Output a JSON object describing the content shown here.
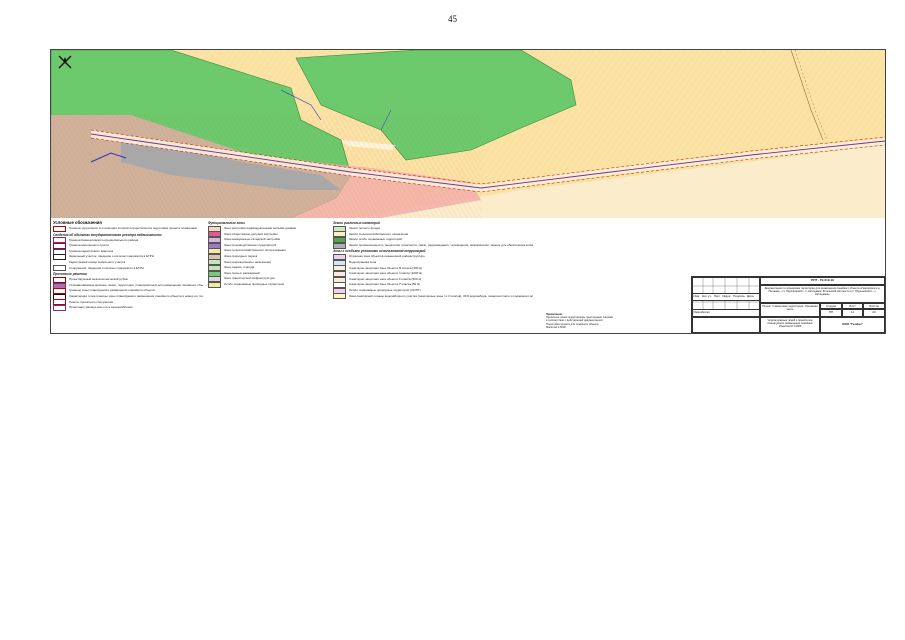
{
  "page_number": "45",
  "legend": {
    "title": "Условные обозначения",
    "col1": [
      {
        "kind": "item",
        "text": "Граница территории, в отношении которой осуществляется подготовка проекта планировки",
        "color": "#ffffff",
        "border": "#c00000"
      },
      {
        "kind": "sub",
        "text": "Сведения об объектах государственного реестра недвижимости"
      },
      {
        "kind": "item",
        "text": "Граница Камышловского муниципального района",
        "color": "#ffffff",
        "border": "#7a2d91"
      },
      {
        "kind": "item",
        "text": "Граница населенного пункта",
        "color": "#ffffff",
        "border": "#c00000"
      },
      {
        "kind": "item",
        "text": "Граница кадастрового квартала",
        "color": "#ffffff",
        "border": "#3030c0"
      },
      {
        "kind": "item",
        "text": "Земельный участок, сведения о котором содержатся в ЕГРН",
        "color": "#ffffff",
        "border": "#222222"
      },
      {
        "kind": "item",
        "text": "Кадастровый номер земельного участка",
        "color": "#ffffff",
        "border": "#ffffff"
      },
      {
        "kind": "item",
        "text": "Сооружения, сведения о которых содержатся в ЕГРН",
        "color": "#ffffff",
        "border": "#555555"
      },
      {
        "kind": "sub",
        "text": "Проектные решения"
      },
      {
        "kind": "item",
        "text": "Проектируемый межпоселенческий рубеж",
        "color": "#ffffff",
        "border": "#a00000"
      },
      {
        "kind": "item",
        "text": "Устанавливаемые красные линии, территория, планировочной для размещения линейного объекта",
        "color": "#b070b0",
        "border": "#7a2d91"
      },
      {
        "kind": "item",
        "text": "Границы зоны планируемого размещения линейного объекта",
        "color": "#ffffff",
        "border": "#c00000"
      },
      {
        "kind": "item",
        "text": "Характерная точка границы зоны планируемого размещения линейного объекта и номер её точки",
        "color": "#ffffff",
        "border": "#111111"
      },
      {
        "kind": "item",
        "text": "Пикеты проектного сооружения",
        "color": "#ffffff",
        "border": "#c00000"
      },
      {
        "kind": "item",
        "text": "Проектная граница зоны хоть высокоаблении",
        "color": "#ffffff",
        "border": "#7a2d91"
      }
    ],
    "col2_head": "Функциональные зоны",
    "col2": [
      {
        "text": "Зона застройки индивидуальными жилыми домами",
        "color": "#f6d7c0"
      },
      {
        "text": "Зона общественно-деловой застройки",
        "color": "#e05a8e"
      },
      {
        "text": "Зона коммунально-складской застройки",
        "color": "#d7b3e0"
      },
      {
        "text": "Зона производственных предприятий",
        "color": "#9a79c8"
      },
      {
        "text": "Зона сельскохозяйственного использования",
        "color": "#f6e7a8"
      },
      {
        "text": "Зона природных парков",
        "color": "#d8c7a8"
      },
      {
        "text": "Зона рекреационного назначения",
        "color": "#bfe6bf"
      },
      {
        "text": "Зона садово, огорода",
        "color": "#c6e2b2"
      },
      {
        "text": "Зона лесных насаждений",
        "color": "#7cc67c"
      },
      {
        "text": "Зона транспортной инфраструктуры",
        "color": "#d9d9d9"
      },
      {
        "text": "Особо охраняемые природные территории",
        "color": "#f5e6a0"
      }
    ],
    "col3_head": "Земли различных категорий",
    "col3": [
      {
        "text": "Земли лесного фонда",
        "color": "#cfe8c4"
      },
      {
        "text": "Земли сельскохозяйственного назначения",
        "color": "#f8f0c0"
      },
      {
        "text": "Земли особо охраняемых территорий",
        "color": "#4fa84f"
      },
      {
        "text": "Земли промышленности, энергетики транспорта, связи, радиовещания, телевидения, информатики, земель для обеспечения космической деятельности, земель обороны",
        "color": "#b0b0b0"
      }
    ],
    "col3_head2": "Зоны с особыми условиями использования территорий",
    "col3b": [
      {
        "text": "Охранная зона объектов инженерной инфраструктуры",
        "color": "#f0d0e8"
      },
      {
        "text": "Водоохранная зона",
        "color": "#d0e8f8"
      },
      {
        "text": "Санитарно-защитная зона объекта III класса (300 м)",
        "color": "#f8f0d8"
      },
      {
        "text": "Санитарно-защитная зона объекта I класса (1000 м)",
        "color": "#f8e8e0"
      },
      {
        "text": "Санитарно-защитная зона объекта II класса (500 м)",
        "color": "#f8ecd8"
      },
      {
        "text": "Санитарно-защитная зона объекта V класса (50 м)",
        "color": "#ffffff"
      },
      {
        "text": "Особо охраняемые природные территории (ООПТ)",
        "color": "#f2d0f0"
      },
      {
        "text": "Зона санитарной охраны водозаборного участка (санитарные зоны I и II поясов), ЗСО водозабора, поверхностного и подземного водоснабжения",
        "color": "#fff6c8"
      }
    ]
  },
  "notes": {
    "title": "Примечания:",
    "lines": [
      "Проектные линии представлены пунктирными линиями",
      "в соответствии с действующей документацией",
      "Подготовка проекта для линейного объекта",
      "Масштаб 1:5000"
    ]
  },
  "stamp": {
    "code": "ППТ - ГК-019-19",
    "title": "Документация по планировке территории для размещения линейного объекта «Газопровод в д. Пылаева – ст. Порошинский – п. Катищевое. В сельской местности в с. Порошинский – с. Катищевое»",
    "stage_head": "Стадия",
    "sheet_head": "Лист",
    "sheets_head": "Листов",
    "stage": "ПП",
    "sheet": "11",
    "sheets": "23",
    "drawing": "Проект планировки территории. Основная часть",
    "drawing_sub": "Чертеж красных линий и проекта зон планируемого размещения линейных объектов М 1:2000",
    "org": "ООО \"Геобаз\"",
    "cols": [
      "Изм.",
      "Кол.уч.",
      "Лист",
      "№док.",
      "Подпись",
      "Дата"
    ],
    "role": "Разработал"
  },
  "map": {
    "colors": {
      "agri": "#fbe3a6",
      "forest": "#6cc96c",
      "sanzone": "#f2a9a9",
      "transport": "#a8a8a8",
      "corridor": "#f8efd7"
    }
  }
}
